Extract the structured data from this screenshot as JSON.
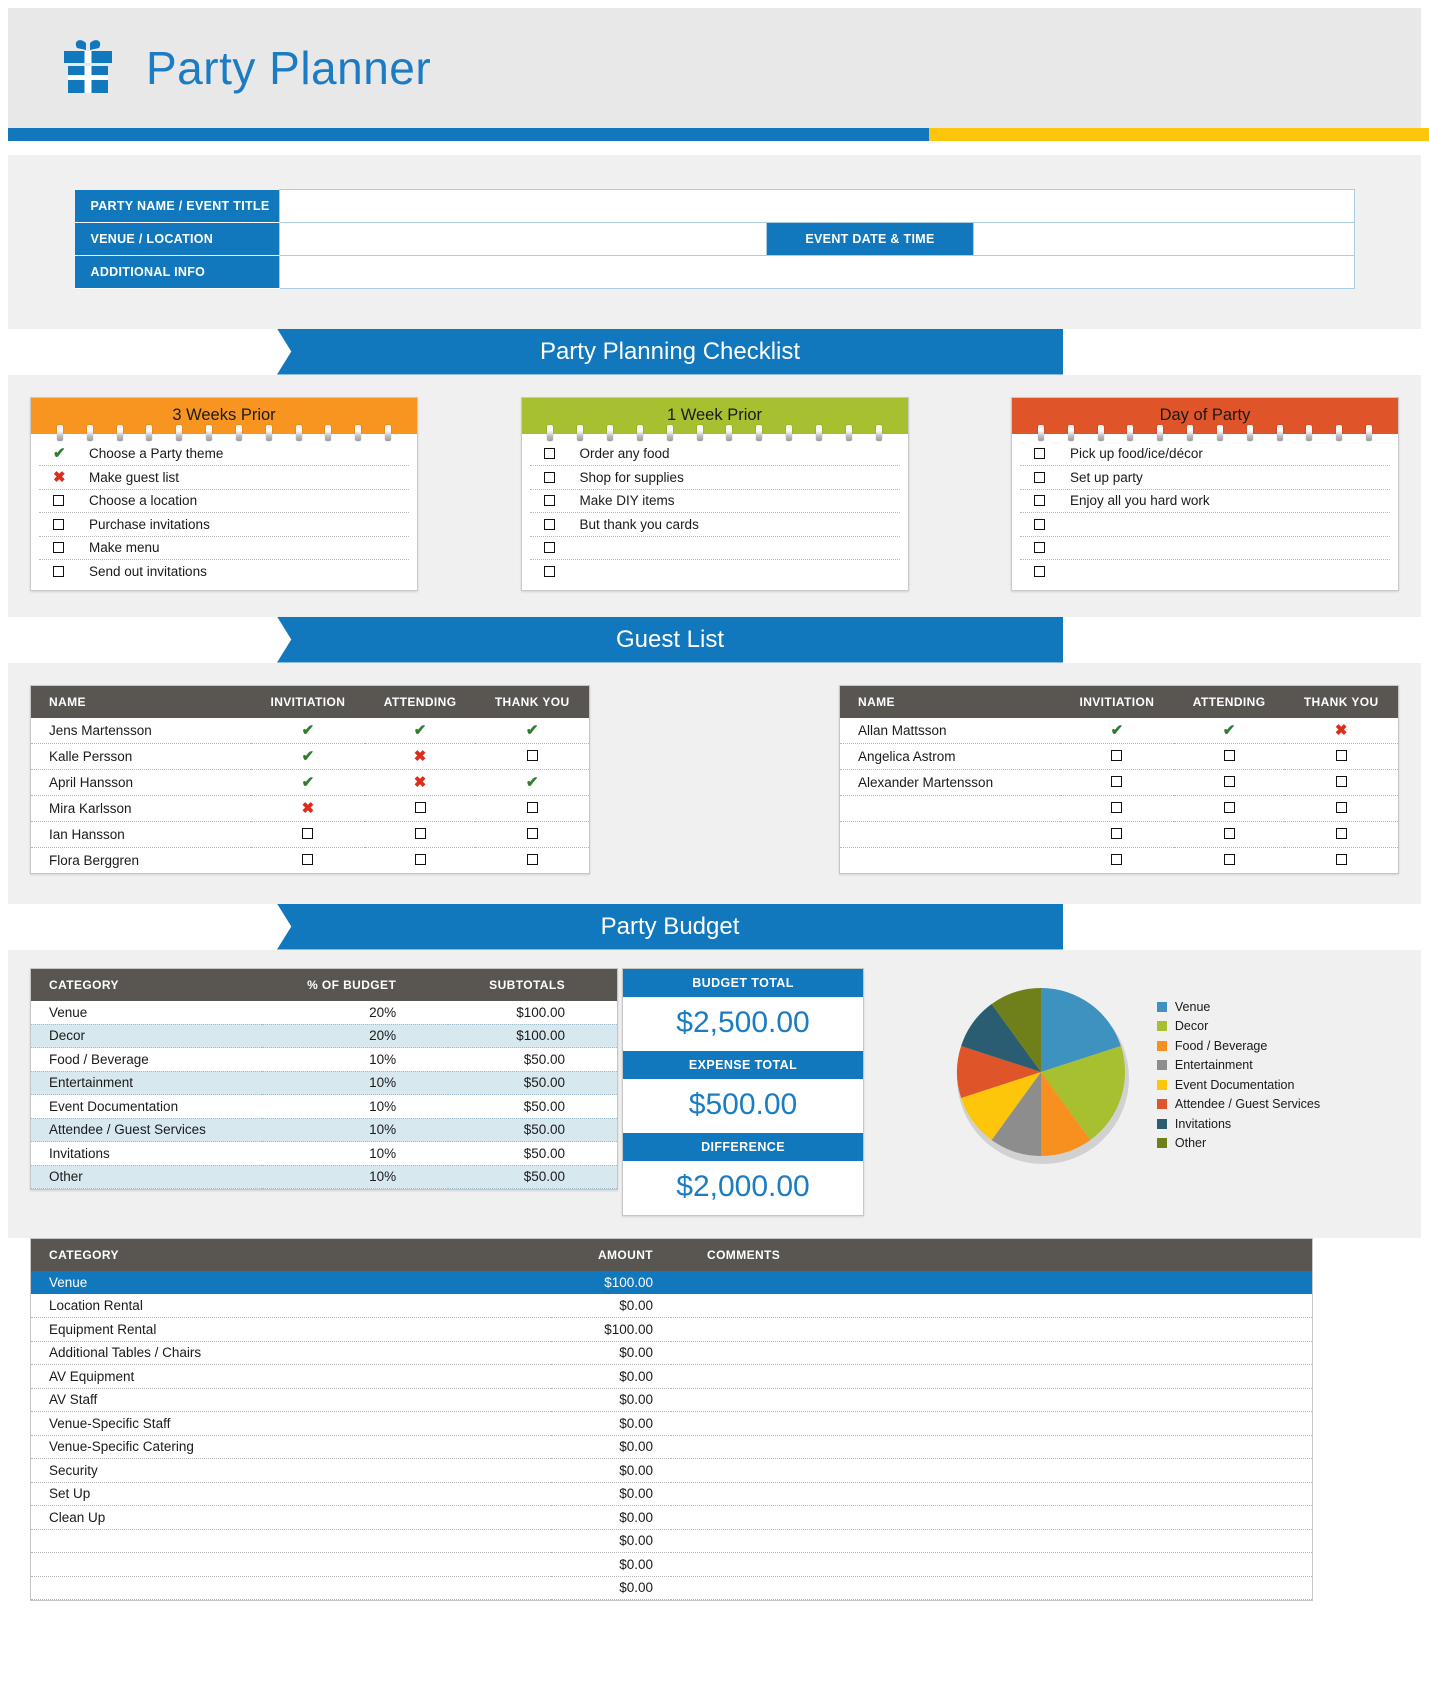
{
  "header": {
    "title": "Party Planner",
    "icon": "gift-icon",
    "accent_blue": "#1178be",
    "accent_gold": "#fdc60b"
  },
  "info": {
    "rows": [
      {
        "label": "PARTY NAME / EVENT TITLE",
        "value": ""
      },
      {
        "label": "VENUE / LOCATION",
        "value": ""
      },
      {
        "label": "ADDITIONAL INFO",
        "value": ""
      }
    ],
    "date_label": "EVENT DATE & TIME",
    "date_value": ""
  },
  "checklist": {
    "banner": "Party Planning Checklist",
    "columns": [
      {
        "title": "3 Weeks Prior",
        "color": "#f79520",
        "items": [
          {
            "mark": "check",
            "text": "Choose a Party theme"
          },
          {
            "mark": "cross",
            "text": "Make guest list"
          },
          {
            "mark": "box",
            "text": "Choose a location"
          },
          {
            "mark": "box",
            "text": "Purchase invitations"
          },
          {
            "mark": "box",
            "text": "Make menu"
          },
          {
            "mark": "box",
            "text": "Send out invitations"
          }
        ]
      },
      {
        "title": "1 Week Prior",
        "color": "#a7c030",
        "items": [
          {
            "mark": "box",
            "text": "Order any food"
          },
          {
            "mark": "box",
            "text": "Shop for supplies"
          },
          {
            "mark": "box",
            "text": "Make DIY items"
          },
          {
            "mark": "box",
            "text": "But thank you cards"
          },
          {
            "mark": "box",
            "text": ""
          },
          {
            "mark": "box",
            "text": ""
          }
        ]
      },
      {
        "title": "Day of Party",
        "color": "#e0542a",
        "items": [
          {
            "mark": "box",
            "text": "Pick up food/ice/décor"
          },
          {
            "mark": "box",
            "text": "Set up party"
          },
          {
            "mark": "box",
            "text": "Enjoy all you hard work"
          },
          {
            "mark": "box",
            "text": ""
          },
          {
            "mark": "box",
            "text": ""
          },
          {
            "mark": "box",
            "text": ""
          }
        ]
      }
    ]
  },
  "guest_list": {
    "banner": "Guest List",
    "columns": [
      "NAME",
      "INVITIATION",
      "ATTENDING",
      "THANK YOU"
    ],
    "left_rows": [
      {
        "name": "Jens Martensson",
        "invitation": "check",
        "attending": "check",
        "thank_you": "check"
      },
      {
        "name": "Kalle Persson",
        "invitation": "check",
        "attending": "cross",
        "thank_you": "box"
      },
      {
        "name": "April Hansson",
        "invitation": "check",
        "attending": "cross",
        "thank_you": "check"
      },
      {
        "name": "Mira Karlsson",
        "invitation": "cross",
        "attending": "box",
        "thank_you": "box"
      },
      {
        "name": "Ian Hansson",
        "invitation": "box",
        "attending": "box",
        "thank_you": "box"
      },
      {
        "name": "Flora Berggren",
        "invitation": "box",
        "attending": "box",
        "thank_you": "box"
      }
    ],
    "right_rows": [
      {
        "name": "Allan Mattsson",
        "invitation": "check",
        "attending": "check",
        "thank_you": "cross"
      },
      {
        "name": "Angelica Astrom",
        "invitation": "box",
        "attending": "box",
        "thank_you": "box"
      },
      {
        "name": "Alexander Martensson",
        "invitation": "box",
        "attending": "box",
        "thank_you": "box"
      },
      {
        "name": "",
        "invitation": "box",
        "attending": "box",
        "thank_you": "box"
      },
      {
        "name": "",
        "invitation": "box",
        "attending": "box",
        "thank_you": "box"
      },
      {
        "name": "",
        "invitation": "box",
        "attending": "box",
        "thank_you": "box"
      }
    ]
  },
  "budget": {
    "banner": "Party Budget",
    "columns": [
      "CATEGORY",
      "% OF BUDGET",
      "SUBTOTALS"
    ],
    "rows": [
      {
        "category": "Venue",
        "percent": "20%",
        "subtotal": "$100.00"
      },
      {
        "category": "Decor",
        "percent": "20%",
        "subtotal": "$100.00"
      },
      {
        "category": "Food / Beverage",
        "percent": "10%",
        "subtotal": "$50.00"
      },
      {
        "category": "Entertainment",
        "percent": "10%",
        "subtotal": "$50.00"
      },
      {
        "category": "Event Documentation",
        "percent": "10%",
        "subtotal": "$50.00"
      },
      {
        "category": "Attendee / Guest Services",
        "percent": "10%",
        "subtotal": "$50.00"
      },
      {
        "category": "Invitations",
        "percent": "10%",
        "subtotal": "$50.00"
      },
      {
        "category": "Other",
        "percent": "10%",
        "subtotal": "$50.00"
      }
    ],
    "totals": [
      {
        "label": "BUDGET TOTAL",
        "value": "$2,500.00"
      },
      {
        "label": "EXPENSE TOTAL",
        "value": "$500.00"
      },
      {
        "label": "DIFFERENCE",
        "value": "$2,000.00"
      }
    ]
  },
  "chart_data": {
    "type": "pie",
    "title": "",
    "legend_position": "right",
    "categories": [
      "Venue",
      "Decor",
      "Food / Beverage",
      "Entertainment",
      "Event Documentation",
      "Attendee / Guest Services",
      "Invitations",
      "Other"
    ],
    "values": [
      20,
      20,
      10,
      10,
      10,
      10,
      10,
      10
    ],
    "units": "% of budget",
    "colors": [
      "#3e92c0",
      "#a7c030",
      "#f7901e",
      "#8d8d8d",
      "#fdc60b",
      "#e0542a",
      "#2a5d72",
      "#6f7f19"
    ],
    "labels_shown": false
  },
  "expenses": {
    "columns": [
      "CATEGORY",
      "AMOUNT",
      "COMMENTS"
    ],
    "rows": [
      {
        "category": "Venue",
        "amount": "$100.00",
        "comments": "",
        "group": true
      },
      {
        "category": "Location Rental",
        "amount": "$0.00",
        "comments": ""
      },
      {
        "category": "Equipment Rental",
        "amount": "$100.00",
        "comments": ""
      },
      {
        "category": "Additional Tables / Chairs",
        "amount": "$0.00",
        "comments": ""
      },
      {
        "category": "AV Equipment",
        "amount": "$0.00",
        "comments": ""
      },
      {
        "category": "AV Staff",
        "amount": "$0.00",
        "comments": ""
      },
      {
        "category": "Venue-Specific Staff",
        "amount": "$0.00",
        "comments": ""
      },
      {
        "category": "Venue-Specific Catering",
        "amount": "$0.00",
        "comments": ""
      },
      {
        "category": "Security",
        "amount": "$0.00",
        "comments": ""
      },
      {
        "category": "Set Up",
        "amount": "$0.00",
        "comments": ""
      },
      {
        "category": "Clean Up",
        "amount": "$0.00",
        "comments": ""
      },
      {
        "category": "",
        "amount": "$0.00",
        "comments": ""
      },
      {
        "category": "",
        "amount": "$0.00",
        "comments": ""
      },
      {
        "category": "",
        "amount": "$0.00",
        "comments": ""
      }
    ]
  }
}
